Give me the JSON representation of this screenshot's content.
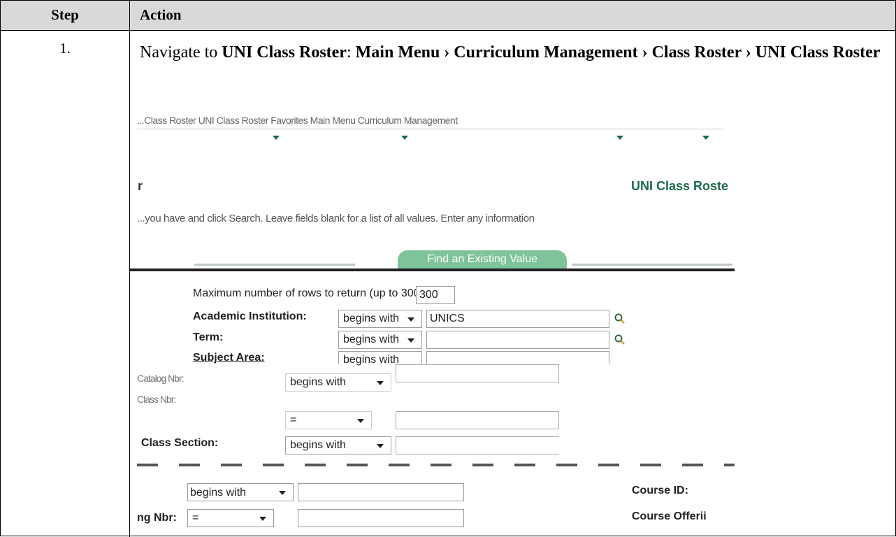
{
  "table": {
    "header_step": "Step",
    "header_action": "Action",
    "step_number": "1.",
    "instruction": {
      "prefix": "Navigate to ",
      "target": "UNI Class Roster",
      "colon": ": ",
      "path": "Main Menu › Curriculum Management › Class Roster › UNI Class Roster"
    }
  },
  "screenshot": {
    "nav_breadcrumb": "...Class Roster  UNI Class Roster  Favorites  Main Menu  Curriculum Management",
    "page_left_fragment": "r",
    "page_title": "UNI Class Roste",
    "instructions": "...you have and click Search. Leave fields blank for a list of all values.    Enter any information",
    "tab_label": "Find an Existing Value",
    "max_rows_label": "Maximum number of rows to return (up to 300):",
    "max_rows_value": "300",
    "fields": {
      "institution": {
        "label": "Academic Institution:",
        "operator": "begins with",
        "value": "UNICS"
      },
      "term": {
        "label": "Term:",
        "operator": "begins with",
        "value": ""
      },
      "subject": {
        "label": "Subject Area:",
        "operator": "begins with",
        "value": ""
      },
      "catalog": {
        "label": "Catalog Nbr:",
        "operator": "begins with",
        "value": ""
      },
      "class_nbr": {
        "label": "Class Nbr:",
        "operator": "=",
        "value": ""
      },
      "class_section": {
        "label": "Class Section:",
        "operator": "begins with",
        "value": ""
      },
      "course_id": {
        "label": "Course ID:",
        "operator": "begins with",
        "value": ""
      },
      "course_offering": {
        "label": "Course Offerii",
        "operator_prefix": "ng Nbr:",
        "operator": "=",
        "value": ""
      }
    }
  },
  "colors": {
    "accent": "#1c6b4a",
    "tab": "#7fc39a",
    "header_bg": "#d9d9d9"
  },
  "icons": [
    "magnifier-icon",
    "dropdown-caret-icon"
  ]
}
